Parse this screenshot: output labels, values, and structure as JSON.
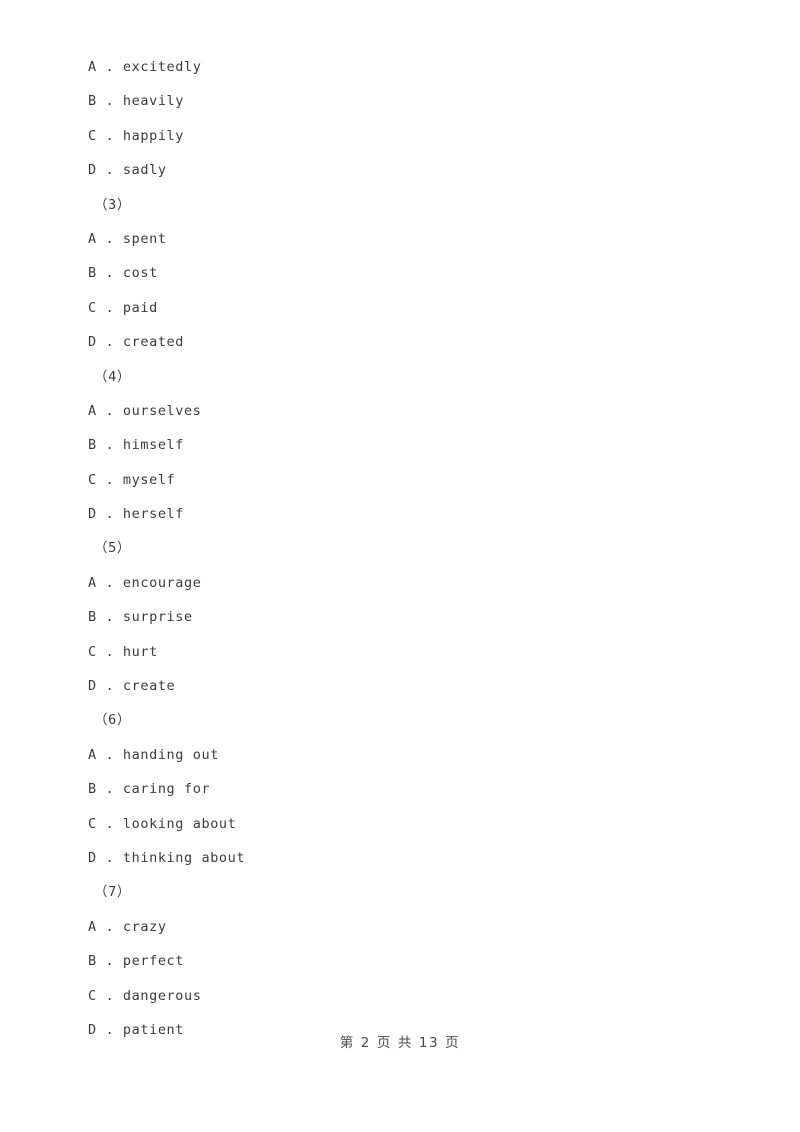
{
  "document": {
    "page_label": "第 2 页 共 13 页",
    "text_color": "#3c3c3c",
    "background_color": "#ffffff"
  },
  "option_separator": " . ",
  "blocks": [
    {
      "kind": "options",
      "options": [
        {
          "letter": "A",
          "text": "excitedly"
        },
        {
          "letter": "B",
          "text": "heavily"
        },
        {
          "letter": "C",
          "text": "happily"
        },
        {
          "letter": "D",
          "text": "sadly"
        }
      ]
    },
    {
      "kind": "number",
      "label": "（3）"
    },
    {
      "kind": "options",
      "options": [
        {
          "letter": "A",
          "text": "spent"
        },
        {
          "letter": "B",
          "text": "cost"
        },
        {
          "letter": "C",
          "text": "paid"
        },
        {
          "letter": "D",
          "text": "created"
        }
      ]
    },
    {
      "kind": "number",
      "label": "（4）"
    },
    {
      "kind": "options",
      "options": [
        {
          "letter": "A",
          "text": "ourselves"
        },
        {
          "letter": "B",
          "text": "himself"
        },
        {
          "letter": "C",
          "text": "myself"
        },
        {
          "letter": "D",
          "text": "herself"
        }
      ]
    },
    {
      "kind": "number",
      "label": "（5）"
    },
    {
      "kind": "options",
      "options": [
        {
          "letter": "A",
          "text": "encourage"
        },
        {
          "letter": "B",
          "text": "surprise"
        },
        {
          "letter": "C",
          "text": "hurt"
        },
        {
          "letter": "D",
          "text": "create"
        }
      ]
    },
    {
      "kind": "number",
      "label": "（6）"
    },
    {
      "kind": "options",
      "options": [
        {
          "letter": "A",
          "text": "handing out"
        },
        {
          "letter": "B",
          "text": "caring for"
        },
        {
          "letter": "C",
          "text": "looking about"
        },
        {
          "letter": "D",
          "text": "thinking about"
        }
      ]
    },
    {
      "kind": "number",
      "label": "（7）"
    },
    {
      "kind": "options",
      "options": [
        {
          "letter": "A",
          "text": "crazy"
        },
        {
          "letter": "B",
          "text": "perfect"
        },
        {
          "letter": "C",
          "text": "dangerous"
        },
        {
          "letter": "D",
          "text": "patient"
        }
      ]
    }
  ]
}
